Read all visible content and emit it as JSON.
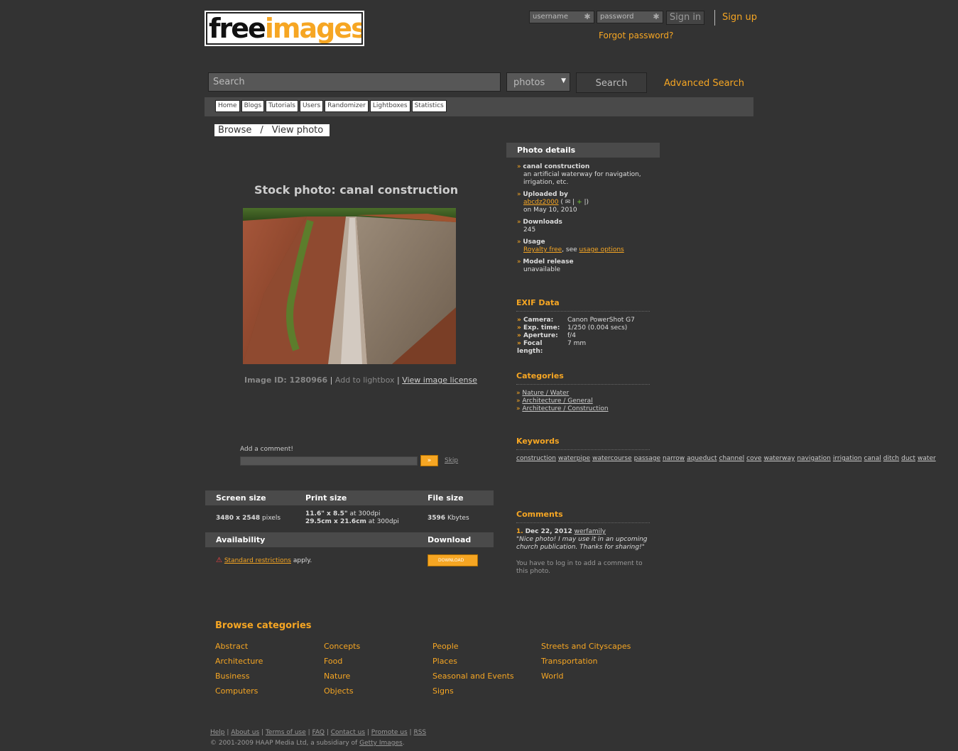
{
  "header": {
    "logo_a": "free",
    "logo_b": "images",
    "username_placeholder": "username",
    "password_placeholder": "password",
    "sign_in": "Sign in",
    "sign_up": "Sign up",
    "forgot": "Forgot password?"
  },
  "search": {
    "placeholder": "Search",
    "scope": "photos",
    "button": "Search",
    "advanced": "Advanced Search"
  },
  "nav": [
    "Home",
    "Blogs",
    "Tutorials",
    "Users",
    "Randomizer",
    "Lightboxes",
    "Statistics"
  ],
  "breadcrumb": {
    "browse": "Browse",
    "sep": "/",
    "current": "View photo"
  },
  "photo": {
    "title": "Stock photo: canal construction",
    "image_id_label": "Image ID: 1280966",
    "add_to_lightbox": "Add to lightbox",
    "view_license": "View image license",
    "add_comment": "Add a comment!",
    "skip": "Skip"
  },
  "sizes": {
    "screen_size_h": "Screen size",
    "print_size_h": "Print size",
    "file_size_h": "File size",
    "screen_size": "3480 x 2548",
    "screen_unit": "pixels",
    "print1": "11.6\" x 8.5\"",
    "print1_suffix": "at 300dpi",
    "print2": "29.5cm x 21.6cm",
    "print2_suffix": "at 300dpi",
    "file_size": "3596",
    "file_unit": "Kbytes",
    "availability_h": "Availability",
    "download_h": "Download",
    "restrictions": "Standard restrictions",
    "apply": "apply.",
    "download_btn": "DOWNLOAD"
  },
  "details": {
    "head": "Photo details",
    "name": "canal construction",
    "desc": "an artificial waterway for navigation, irrigation, etc.",
    "uploaded_by": "Uploaded by",
    "uploader": "abcdz2000",
    "uploaded_on": "on May 10, 2010",
    "downloads": "Downloads",
    "downloads_count": "245",
    "usage": "Usage",
    "royalty": "Royalty free",
    "see": ", see",
    "usage_options": "usage options",
    "model_release": "Model release",
    "model_value": "unavailable"
  },
  "exif": {
    "head": "EXIF Data",
    "rows": [
      {
        "k": "Camera:",
        "v": "Canon PowerShot G7"
      },
      {
        "k": "Exp. time:",
        "v": "1/250 (0.004 secs)"
      },
      {
        "k": "Aperture:",
        "v": "f/4"
      },
      {
        "k": "Focal length:",
        "v": "7 mm"
      }
    ]
  },
  "categories": {
    "head": "Categories",
    "items": [
      "Nature / Water",
      "Architecture / General",
      "Architecture / Construction"
    ]
  },
  "keywords": {
    "head": "Keywords",
    "items": [
      "construction",
      "waterpipe",
      "watercourse",
      "passage",
      "narrow",
      "aqueduct",
      "channel",
      "cove",
      "waterway",
      "navigation",
      "irrigation",
      "canal",
      "ditch",
      "duct",
      "water"
    ]
  },
  "comments": {
    "head": "Comments",
    "num": "1.",
    "date": "Dec 22, 2012",
    "user": "werfamily",
    "text": "\"Nice photo! I may use it in an upcoming church publication. Thanks for sharing!\"",
    "login_note": "You have to log in to add a comment to this photo."
  },
  "browse": {
    "head": "Browse categories",
    "cols": [
      [
        "Abstract",
        "Architecture",
        "Business",
        "Computers"
      ],
      [
        "Concepts",
        "Food",
        "Nature",
        "Objects"
      ],
      [
        "People",
        "Places",
        "Seasonal and Events",
        "Signs"
      ],
      [
        "Streets and Cityscapes",
        "Transportation",
        "World"
      ]
    ]
  },
  "footer": {
    "links": [
      "Help",
      "About us",
      "Terms of use",
      "FAQ",
      "Contact us",
      "Promote us",
      "RSS"
    ],
    "copyright": "© 2001-2009 HAAP Media Ltd, a subsidiary of",
    "getty": "Getty Images",
    "period": "."
  },
  "colors": {
    "accent": "#f6a623",
    "bg": "#333333",
    "panel": "#4a4a4a"
  }
}
